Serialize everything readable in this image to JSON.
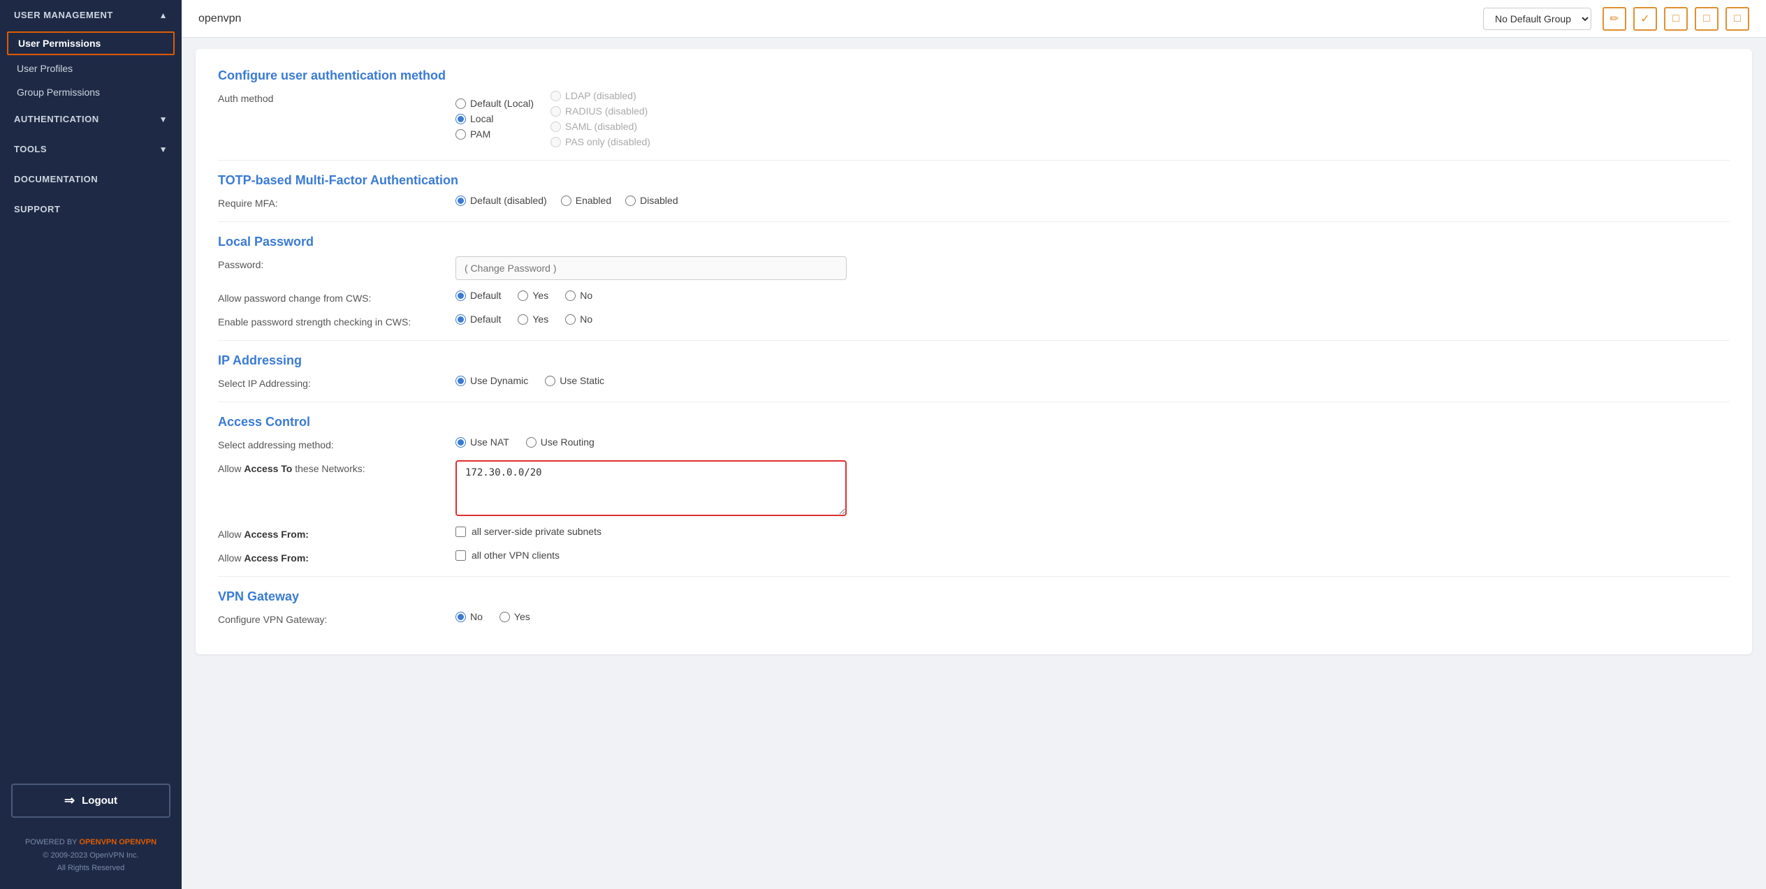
{
  "sidebar": {
    "sections": [
      {
        "id": "user-management",
        "label": "USER MANAGEMENT",
        "collapsible": true,
        "expanded": true,
        "items": [
          {
            "id": "user-permissions",
            "label": "User Permissions",
            "active": true
          },
          {
            "id": "user-profiles",
            "label": "User Profiles",
            "active": false
          },
          {
            "id": "group-permissions",
            "label": "Group Permissions",
            "active": false
          }
        ]
      },
      {
        "id": "authentication",
        "label": "AUTHENTICATION",
        "collapsible": true,
        "expanded": false,
        "items": []
      },
      {
        "id": "tools",
        "label": "TOOLS",
        "collapsible": true,
        "expanded": false,
        "items": []
      },
      {
        "id": "documentation",
        "label": "DOCUMENTATION",
        "collapsible": false,
        "expanded": false,
        "items": []
      },
      {
        "id": "support",
        "label": "SUPPORT",
        "collapsible": false,
        "expanded": false,
        "items": []
      }
    ],
    "logout_label": "Logout",
    "powered_by": "POWERED BY",
    "brand": "OPENVPN",
    "copyright": "© 2009-2023 OpenVPN Inc.",
    "rights": "All Rights Reserved"
  },
  "topbar": {
    "username": "openvpn",
    "group_select_label": "No Default Group",
    "group_options": [
      "No Default Group"
    ],
    "icons": [
      {
        "id": "edit",
        "symbol": "✏",
        "filled": false
      },
      {
        "id": "check",
        "symbol": "✓",
        "filled": false
      },
      {
        "id": "square1",
        "symbol": "□",
        "filled": false
      },
      {
        "id": "square2",
        "symbol": "□",
        "filled": false
      },
      {
        "id": "square3",
        "symbol": "□",
        "filled": false
      }
    ]
  },
  "form": {
    "auth_method_section": {
      "title": "Configure user authentication method",
      "label": "Auth method",
      "options_left": [
        {
          "id": "default-local",
          "label": "Default (Local)",
          "checked": false
        },
        {
          "id": "local",
          "label": "Local",
          "checked": true
        },
        {
          "id": "pam",
          "label": "PAM",
          "checked": false
        }
      ],
      "options_right": [
        {
          "id": "ldap",
          "label": "LDAP (disabled)",
          "disabled": true
        },
        {
          "id": "radius",
          "label": "RADIUS (disabled)",
          "disabled": true
        },
        {
          "id": "saml",
          "label": "SAML (disabled)",
          "disabled": true
        },
        {
          "id": "pas",
          "label": "PAS only (disabled)",
          "disabled": true
        }
      ]
    },
    "mfa_section": {
      "title": "TOTP-based Multi-Factor Authentication",
      "label": "Require MFA:",
      "options": [
        {
          "id": "mfa-default",
          "label": "Default (disabled)",
          "checked": true
        },
        {
          "id": "mfa-enabled",
          "label": "Enabled",
          "checked": false
        },
        {
          "id": "mfa-disabled",
          "label": "Disabled",
          "checked": false
        }
      ]
    },
    "local_password_section": {
      "title": "Local Password",
      "password_label": "Password:",
      "password_placeholder": "( Change Password )",
      "allow_change_label": "Allow password change from CWS:",
      "allow_change_options": [
        {
          "id": "change-default",
          "label": "Default",
          "checked": true
        },
        {
          "id": "change-yes",
          "label": "Yes",
          "checked": false
        },
        {
          "id": "change-no",
          "label": "No",
          "checked": false
        }
      ],
      "strength_label": "Enable password strength checking in CWS:",
      "strength_options": [
        {
          "id": "strength-default",
          "label": "Default",
          "checked": true
        },
        {
          "id": "strength-yes",
          "label": "Yes",
          "checked": false
        },
        {
          "id": "strength-no",
          "label": "No",
          "checked": false
        }
      ]
    },
    "ip_addressing_section": {
      "title": "IP Addressing",
      "label": "Select IP Addressing:",
      "options": [
        {
          "id": "use-dynamic",
          "label": "Use Dynamic",
          "checked": true
        },
        {
          "id": "use-static",
          "label": "Use Static",
          "checked": false
        }
      ]
    },
    "access_control_section": {
      "title": "Access Control",
      "addressing_label": "Select addressing method:",
      "addressing_options": [
        {
          "id": "use-nat",
          "label": "Use NAT",
          "checked": true
        },
        {
          "id": "use-routing",
          "label": "Use Routing",
          "checked": false
        }
      ],
      "access_to_label": "Allow",
      "access_to_bold": "Access To",
      "access_to_suffix": "these Networks:",
      "access_to_value": "172.30.0.0/20",
      "access_from_label1": "Allow",
      "access_from_bold1": "Access From:",
      "access_from_check1": "all server-side private subnets",
      "access_from_label2": "Allow",
      "access_from_bold2": "Access From:",
      "access_from_check2": "all other VPN clients"
    },
    "vpn_gateway_section": {
      "title": "VPN Gateway",
      "label": "Configure VPN Gateway:",
      "options": [
        {
          "id": "gw-no",
          "label": "No",
          "checked": true
        },
        {
          "id": "gw-yes",
          "label": "Yes",
          "checked": false
        }
      ]
    }
  }
}
